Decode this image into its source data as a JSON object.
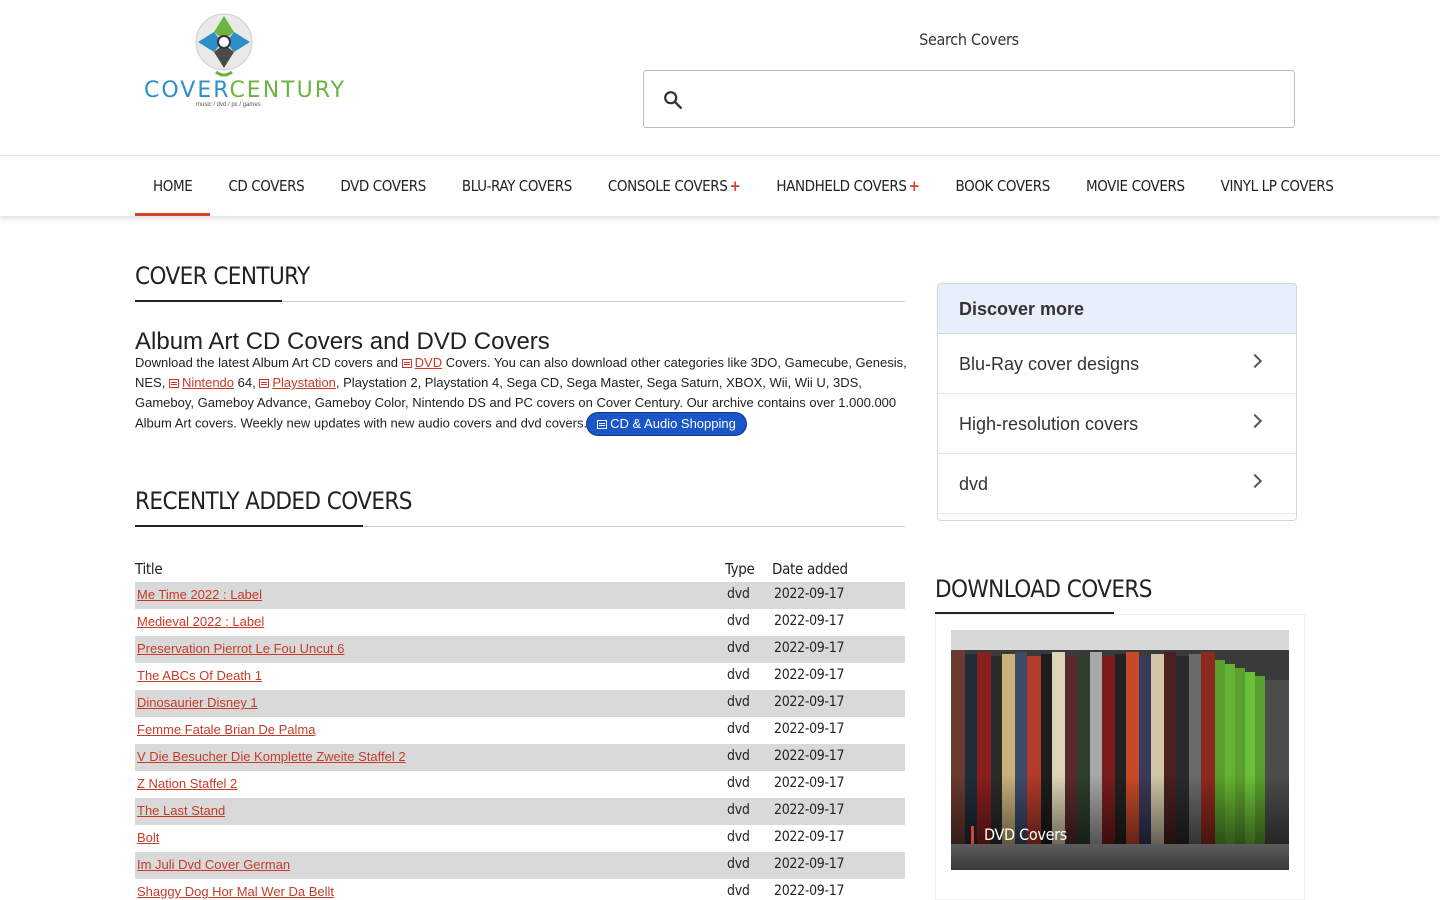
{
  "brand": {
    "wordmark_a": "COVER",
    "wordmark_b": "CENTURY",
    "tagline": "music / dvd / pc / games"
  },
  "search": {
    "label": "Search Covers",
    "value": "",
    "icon": "search-icon"
  },
  "nav": {
    "items": [
      {
        "label": "Home",
        "plus": ""
      },
      {
        "label": "CD Covers",
        "plus": ""
      },
      {
        "label": "DVD Covers",
        "plus": ""
      },
      {
        "label": "Blu-Ray Covers",
        "plus": ""
      },
      {
        "label": "Console Covers",
        "plus": "+"
      },
      {
        "label": "Handheld Covers",
        "plus": "+"
      },
      {
        "label": "Book Covers",
        "plus": ""
      },
      {
        "label": "Movie Covers",
        "plus": ""
      },
      {
        "label": "Vinyl LP Covers",
        "plus": ""
      }
    ]
  },
  "main": {
    "section_title": "Cover Century",
    "heading": "Album Art CD Covers and DVD Covers",
    "intro": {
      "p1": "Download the latest Album Art CD covers and ",
      "link_dvd": "DVD",
      "p2": " Covers. You can also download other categories like 3DO, Gamecube, Genesis, NES, ",
      "link_nintendo": "Nintendo",
      "p3": " 64, ",
      "link_playstation": "Playstation",
      "p4": ", Playstation 2, Playstation 4, Sega CD, Sega Master, Sega Saturn, XBOX, Wii, Wii U, 3DS, Gameboy, Gameboy Advance, Gameboy Color, Nintendo DS and PC covers on Cover Century. Our archive contains over 1.000.000 Album Art covers. Weekly new updates with new audio covers and dvd covers.",
      "shop_pill": "CD & Audio Shopping"
    },
    "recent_title": "Recently added covers",
    "table": {
      "headers": {
        "title": "Title",
        "type": "Type",
        "date": "Date added"
      },
      "rows": [
        {
          "title": "Me Time 2022 : Label",
          "type": "dvd",
          "date": "2022-09-17"
        },
        {
          "title": "Medieval 2022 : Label",
          "type": "dvd",
          "date": "2022-09-17"
        },
        {
          "title": "Preservation Pierrot Le Fou Uncut 6",
          "type": "dvd",
          "date": "2022-09-17"
        },
        {
          "title": "The ABCs Of Death 1",
          "type": "dvd",
          "date": "2022-09-17"
        },
        {
          "title": "Dinosaurier Disney 1",
          "type": "dvd",
          "date": "2022-09-17"
        },
        {
          "title": "Femme Fatale Brian De Palma",
          "type": "dvd",
          "date": "2022-09-17"
        },
        {
          "title": "V Die Besucher Die Komplette Zweite Staffel 2",
          "type": "dvd",
          "date": "2022-09-17"
        },
        {
          "title": "Z Nation Staffel 2",
          "type": "dvd",
          "date": "2022-09-17"
        },
        {
          "title": "The Last Stand",
          "type": "dvd",
          "date": "2022-09-17"
        },
        {
          "title": "Bolt",
          "type": "dvd",
          "date": "2022-09-17"
        },
        {
          "title": "Im Juli Dvd Cover German",
          "type": "dvd",
          "date": "2022-09-17"
        },
        {
          "title": "Shaggy Dog Hor Mal Wer Da Bellt",
          "type": "dvd",
          "date": "2022-09-17"
        }
      ]
    }
  },
  "sidebar": {
    "discover_title": "Discover more",
    "discover_items": [
      "Blu-Ray cover designs",
      "High-resolution covers",
      "dvd"
    ],
    "download_title": "Download covers",
    "card_caption": "DVD Covers"
  },
  "colors": {
    "accent": "#d6412a",
    "link": "#c53b27",
    "pill": "#1a56c9",
    "row_alt": "#d9d9d9"
  }
}
